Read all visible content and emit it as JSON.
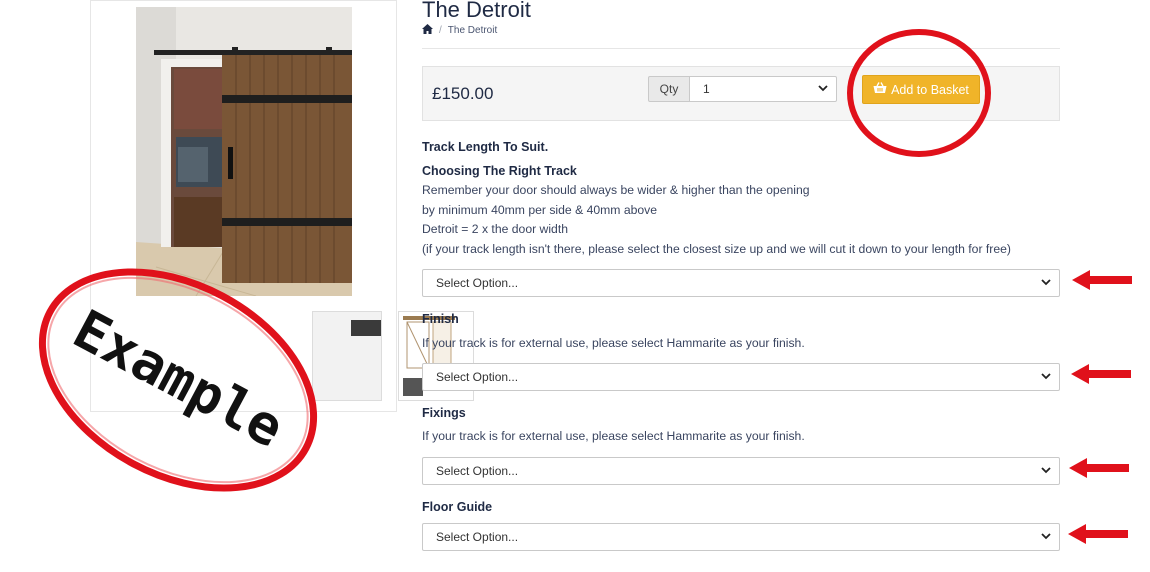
{
  "product": {
    "title": "The Detroit",
    "breadcrumb_current": "The Detroit",
    "price": "£150.00",
    "qty_label": "Qty",
    "qty_value": "1",
    "add_button_label": "Add to Basket"
  },
  "sections": {
    "track_heading": "Track Length To Suit.",
    "choosing_heading": "Choosing The Right Track",
    "line1": "Remember your door should always be wider & higher than the opening",
    "line2": "by minimum 40mm per side & 40mm above",
    "line3": "Detroit = 2 x the door width",
    "line4": "(if your track length isn't there, please select the closest size up and we will cut it down to your length for free)",
    "finish_heading": "Finish",
    "finish_note": "If your track is for external use, please select Hammarite as your finish.",
    "fixings_heading": "Fixings",
    "fixings_note": "If your track is for external use, please select Hammarite as your finish.",
    "floor_heading": "Floor Guide"
  },
  "selects": {
    "track": "Select Option...",
    "finish": "Select Option...",
    "fixings": "Select Option...",
    "floor": "Select Option..."
  },
  "annotation": {
    "stamp_text": "Example",
    "highlight_color": "#e0111b"
  },
  "icons": {
    "home": "home-icon",
    "basket": "basket-icon",
    "chevron": "chevron-down-icon"
  }
}
